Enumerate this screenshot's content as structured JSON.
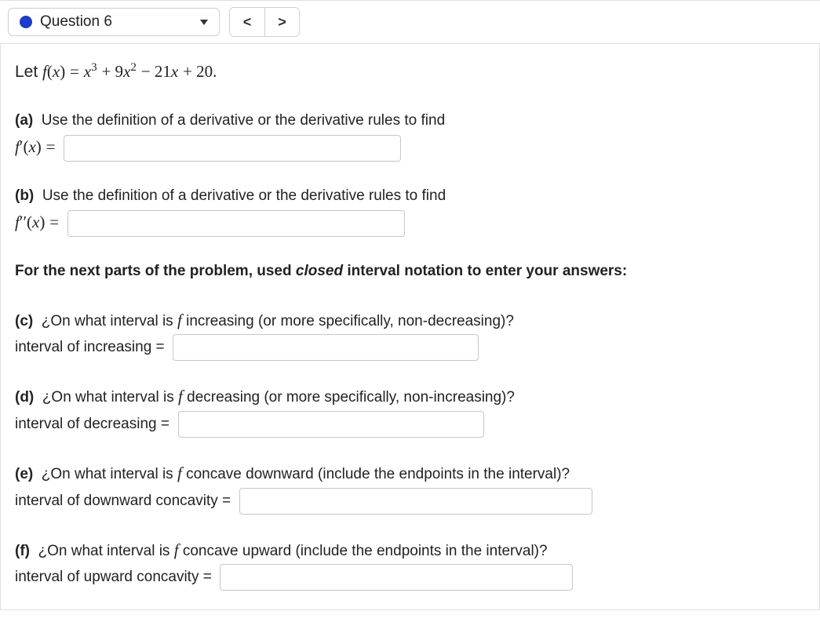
{
  "header": {
    "question_label": "Question 6",
    "prev_glyph": "<",
    "next_glyph": ">"
  },
  "intro": {
    "let_prefix": "Let ",
    "fx_label": "f(x) = ",
    "poly_html": "x³ + 9x² − 21x + 20."
  },
  "parts": {
    "a": {
      "label": "(a)",
      "text": "Use the definition of a derivative or the derivative rules to find",
      "lhs": "f′(x) ="
    },
    "b": {
      "label": "(b)",
      "text": "Use the definition of a derivative or the derivative rules to find",
      "lhs": "f′′(x) ="
    },
    "mid_note": "For the next parts of the problem, used closed interval notation to enter your answers:",
    "c": {
      "label": "(c)",
      "text": "¿On what interval is f increasing (or more specifically, non-decreasing)?",
      "lhs": "interval of increasing ="
    },
    "d": {
      "label": "(d)",
      "text": "¿On what interval is f decreasing (or more specifically, non-increasing)?",
      "lhs": "interval of decreasing ="
    },
    "e": {
      "label": "(e)",
      "text": "¿On what interval is f concave downward (include the endpoints in the interval)?",
      "lhs": "interval of downward concavity ="
    },
    "f": {
      "label": "(f)",
      "text": "¿On what interval is f concave upward (include the endpoints in the interval)?",
      "lhs": "interval of upward concavity ="
    }
  }
}
